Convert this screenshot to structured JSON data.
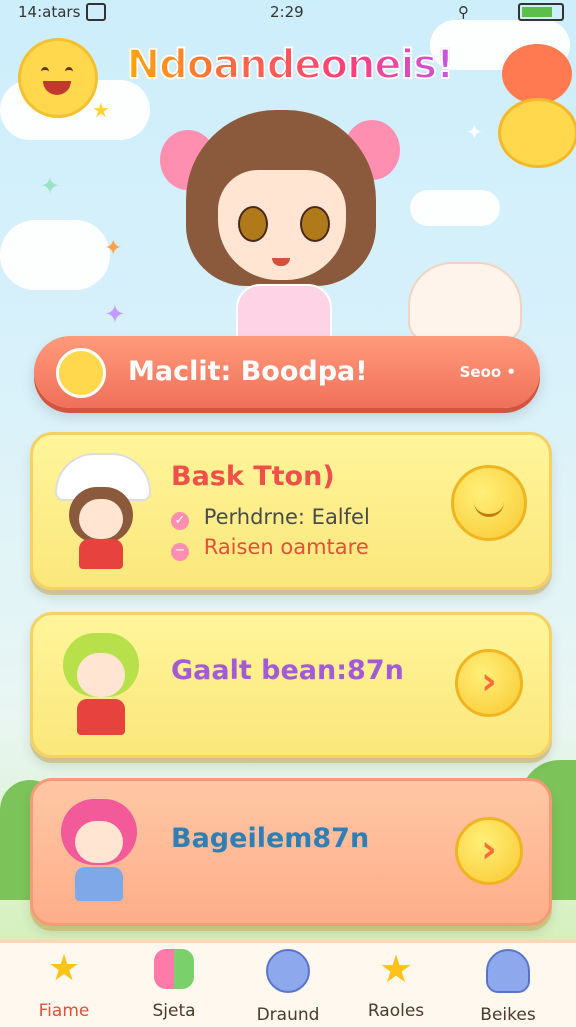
{
  "status_bar": {
    "left": "14:atars",
    "time": "2:29"
  },
  "title": "Ndoandeoneis!",
  "banner": {
    "label": "Maclit: Boodpa!",
    "score": "Seoo •"
  },
  "cards": [
    {
      "title": "Bask Tton)",
      "items": [
        {
          "marker": "✓",
          "text": "Perhdrne: Ealfel"
        },
        {
          "marker": "−",
          "text": "Raisen oamtare"
        }
      ]
    },
    {
      "title": "Gaalt bean:87n",
      "button": "›"
    },
    {
      "title": "Bageilem87n",
      "button": "›"
    }
  ],
  "nav": [
    {
      "icon": "star-icon",
      "label": "Fiame"
    },
    {
      "icon": "gift-box-icon",
      "label": "Sjeta"
    },
    {
      "icon": "blob-face-icon",
      "label": "Draund"
    },
    {
      "icon": "star-face-icon",
      "label": "Raoles"
    },
    {
      "icon": "blob-creature-icon",
      "label": "Beikes"
    }
  ],
  "colors": {
    "banner": "#f0705a",
    "card_yellow": "#fbe77b",
    "card_orange": "#ffad8a",
    "accent": "#ff6e3a"
  }
}
